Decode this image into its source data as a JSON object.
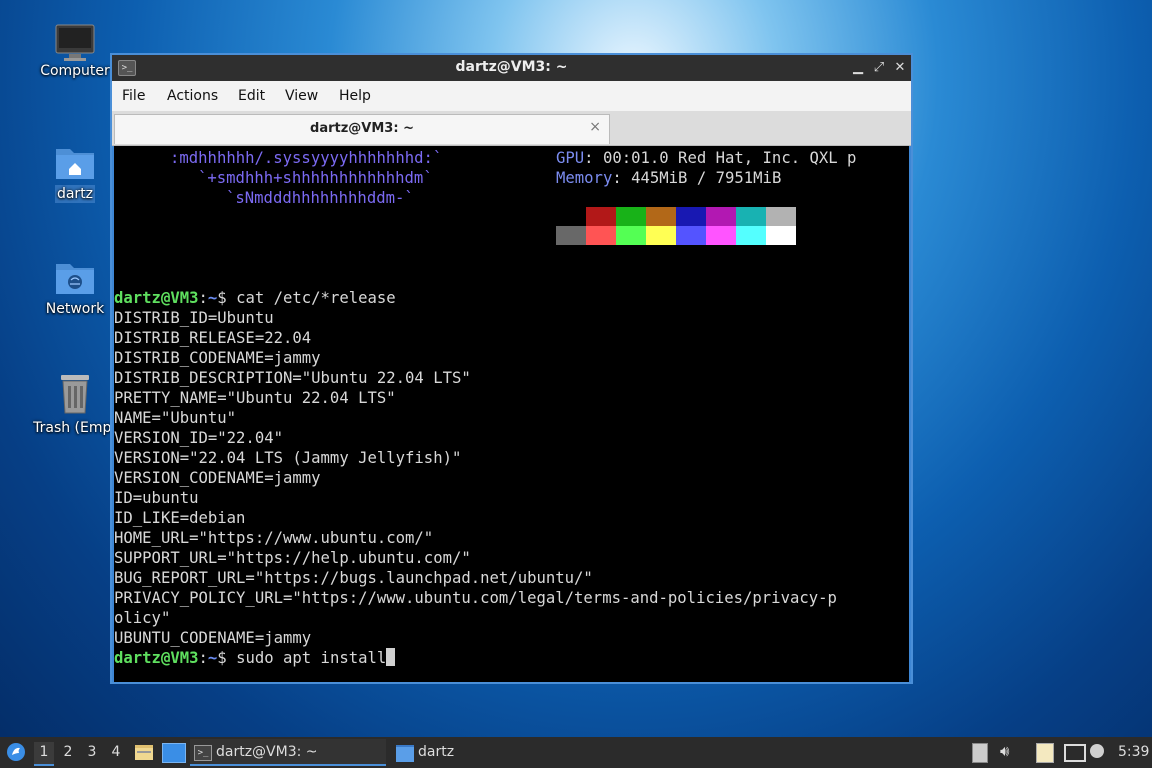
{
  "desktop": {
    "icons": [
      {
        "label": "Computer"
      },
      {
        "label": "dartz"
      },
      {
        "label": "Network"
      },
      {
        "label": "Trash (Empt"
      }
    ]
  },
  "window": {
    "title": "dartz@VM3: ~",
    "menu": [
      "File",
      "Actions",
      "Edit",
      "View",
      "Help"
    ],
    "tab_title": "dartz@VM3: ~",
    "tab_close": "×"
  },
  "terminal": {
    "art": [
      ":mdhhhhhh/.syssyyyyhhhhhhhd:`",
      "`+smdhhh+shhhhhhhhhhhhdm`",
      "`sNmdddhhhhhhhhddm-`"
    ],
    "info": [
      {
        "key": "GPU",
        "value": ": 00:01.0 Red Hat, Inc. QXL p"
      },
      {
        "key": "Memory",
        "value": ": 445MiB / 7951MiB"
      }
    ],
    "palette_top": [
      "#000000",
      "#b21818",
      "#18b218",
      "#b26818",
      "#1818b2",
      "#b218b2",
      "#18b2b2",
      "#b2b2b2"
    ],
    "palette_bottom": [
      "#686868",
      "#ff5454",
      "#54ff54",
      "#ffff54",
      "#5454ff",
      "#ff54ff",
      "#54ffff",
      "#ffffff"
    ],
    "prompt_user": "dartz@VM3",
    "prompt_colon": ":",
    "prompt_path": "~",
    "prompt_dollar": "$ ",
    "command1": "cat /etc/*release",
    "output": [
      "DISTRIB_ID=Ubuntu",
      "DISTRIB_RELEASE=22.04",
      "DISTRIB_CODENAME=jammy",
      "DISTRIB_DESCRIPTION=\"Ubuntu 22.04 LTS\"",
      "PRETTY_NAME=\"Ubuntu 22.04 LTS\"",
      "NAME=\"Ubuntu\"",
      "VERSION_ID=\"22.04\"",
      "VERSION=\"22.04 LTS (Jammy Jellyfish)\"",
      "VERSION_CODENAME=jammy",
      "ID=ubuntu",
      "ID_LIKE=debian",
      "HOME_URL=\"https://www.ubuntu.com/\"",
      "SUPPORT_URL=\"https://help.ubuntu.com/\"",
      "BUG_REPORT_URL=\"https://bugs.launchpad.net/ubuntu/\"",
      "PRIVACY_POLICY_URL=\"https://www.ubuntu.com/legal/terms-and-policies/privacy-p",
      "olicy\"",
      "UBUNTU_CODENAME=jammy"
    ],
    "command2": "sudo apt install"
  },
  "taskbar": {
    "workspaces": [
      "1",
      "2",
      "3",
      "4"
    ],
    "active_workspace": "1",
    "tasks": [
      {
        "label": "dartz@VM3: ~",
        "icon": "terminal-icon"
      },
      {
        "label": "dartz",
        "icon": "folder-icon"
      }
    ],
    "clock": "5:39"
  }
}
